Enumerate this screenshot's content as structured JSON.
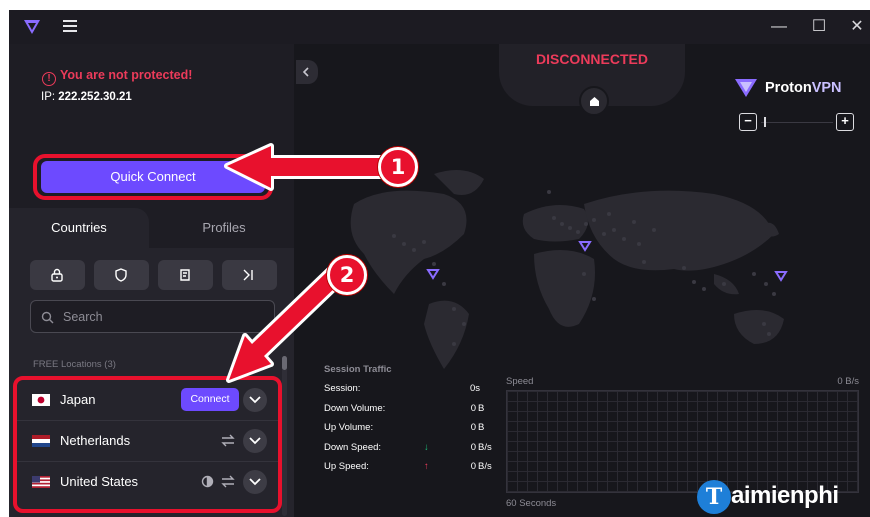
{
  "app": {
    "brand_name": "Proton",
    "brand_suffix": "VPN",
    "accent_color": "#6d4aff",
    "alert_color": "#ec3b5a"
  },
  "window_controls": {
    "minimize": "—",
    "maximize": "☐",
    "close": "✕"
  },
  "status": {
    "warning_text": "You are not protected!",
    "ip_label": "IP:",
    "ip_value": "222.252.30.21",
    "connection_state": "DISCONNECTED"
  },
  "quick_connect": {
    "label": "Quick Connect"
  },
  "tabs": [
    {
      "label": "Countries",
      "active": true
    },
    {
      "label": "Profiles",
      "active": false
    }
  ],
  "filters": [
    {
      "icon": "lock-icon"
    },
    {
      "icon": "shield-icon"
    },
    {
      "icon": "tor-icon"
    },
    {
      "icon": "p2p-icon"
    }
  ],
  "search": {
    "placeholder": "Search"
  },
  "free_locations_label": "FREE Locations (3)",
  "countries": [
    {
      "name": "Japan",
      "flag": "japan-flag",
      "connect_label": "Connect"
    },
    {
      "name": "Netherlands",
      "flag": "netherlands-flag"
    },
    {
      "name": "United States",
      "flag": "usa-flag"
    }
  ],
  "session_traffic": {
    "title": "Session Traffic",
    "rows": [
      {
        "label": "Session:",
        "value": "0s",
        "unit": ""
      },
      {
        "label": "Down Volume:",
        "value": "0",
        "unit": "B"
      },
      {
        "label": "Up Volume:",
        "value": "0",
        "unit": "B"
      },
      {
        "label": "Down Speed:",
        "value": "0",
        "unit": "B/s",
        "arrow": "↓"
      },
      {
        "label": "Up Speed:",
        "value": "0",
        "unit": "B/s",
        "arrow": "↑"
      }
    ]
  },
  "speed_graph": {
    "title": "Speed",
    "rate": "0 B/s",
    "window": "60 Seconds"
  },
  "annotations": [
    {
      "number": "1"
    },
    {
      "number": "2"
    }
  ],
  "watermark": {
    "letter": "T",
    "text": "aimienphi"
  }
}
